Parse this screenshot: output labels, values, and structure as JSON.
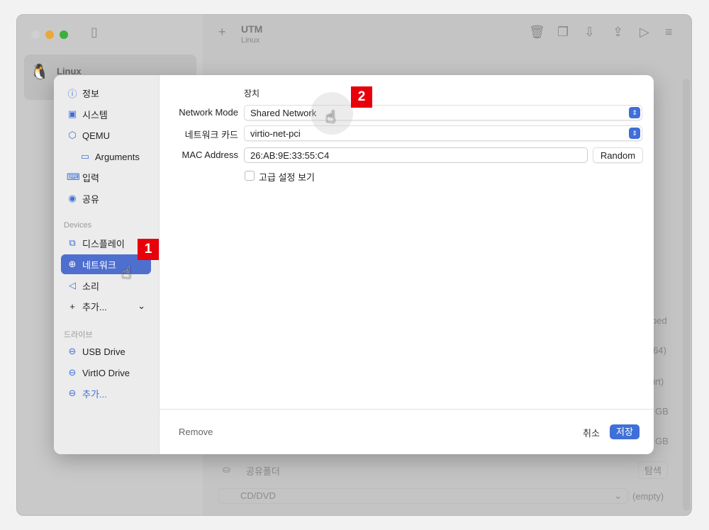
{
  "window": {
    "title": "UTM",
    "subtitle": "Linux",
    "vm_name": "Linux"
  },
  "background": {
    "right_fragments": [
      "ped",
      "64)",
      "irt)",
      "GB",
      "GB"
    ],
    "shared_folder": "공유폴더",
    "browse": "탐색",
    "cd_label": "CD/DVD",
    "cd_value": "(empty)"
  },
  "sidebar": {
    "items": [
      {
        "label": "정보",
        "icon": "info-icon"
      },
      {
        "label": "시스템",
        "icon": "cpu-icon"
      },
      {
        "label": "QEMU",
        "icon": "cube-icon"
      },
      {
        "label": "Arguments",
        "icon": "terminal-icon"
      },
      {
        "label": "입력",
        "icon": "keyboard-icon"
      },
      {
        "label": "공유",
        "icon": "person-icon"
      }
    ],
    "devices_header": "Devices",
    "devices": [
      {
        "label": "디스플레이",
        "icon": "display-icon"
      },
      {
        "label": "네트워크",
        "icon": "globe-icon",
        "selected": true
      },
      {
        "label": "소리",
        "icon": "speaker-icon"
      },
      {
        "label": "추가...",
        "icon": "plus-icon"
      }
    ],
    "drives_header": "드라이브",
    "drives": [
      {
        "label": "USB Drive",
        "icon": "drive-icon"
      },
      {
        "label": "VirtIO Drive",
        "icon": "drive-icon"
      },
      {
        "label": "추가...",
        "icon": "drive-add-icon"
      }
    ]
  },
  "form": {
    "section": "장치",
    "network_mode_label": "Network Mode",
    "network_mode": "Shared Network",
    "card_label": "네트워크 카드",
    "card": "virtio-net-pci",
    "mac_label": "MAC Address",
    "mac": "26:AB:9E:33:55:C4",
    "random": "Random",
    "advanced": "고급 설정 보기",
    "advanced_checked": false
  },
  "footer": {
    "remove": "Remove",
    "cancel": "취소",
    "save": "저장"
  },
  "annotations": [
    "1",
    "2"
  ],
  "colors": {
    "accent": "#4f6fcf",
    "badge": "#e8000b"
  }
}
